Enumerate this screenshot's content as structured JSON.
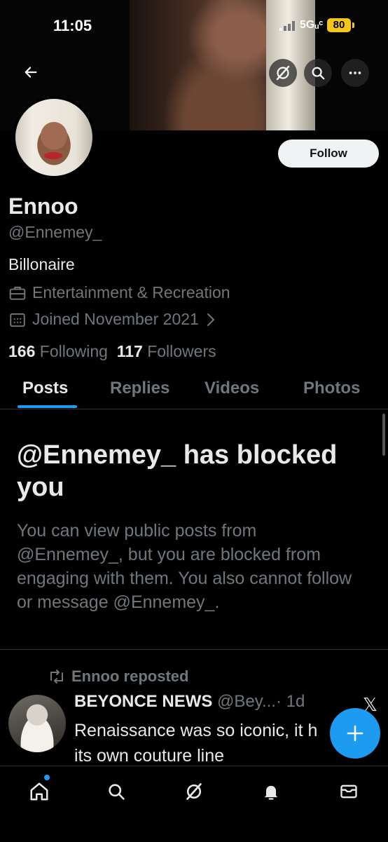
{
  "status_bar": {
    "time": "11:05",
    "network": "5Gᵤᶜ",
    "battery": "80"
  },
  "profile": {
    "name": "Ennoo",
    "handle": "@Ennemey_",
    "bio": "Billonaire",
    "category": "Entertainment & Recreation",
    "joined": "Joined November 2021",
    "following_count": "166",
    "following_label": "Following",
    "followers_count": "117",
    "followers_label": "Followers",
    "follow_button": "Follow"
  },
  "tabs": [
    "Posts",
    "Replies",
    "Videos",
    "Photos"
  ],
  "blocked": {
    "title": "@Ennemey_ has blocked you",
    "body": "You can view public posts from @Ennemey_, but you are blocked from engaging with them. You also cannot follow or message @Ennemey_."
  },
  "post": {
    "repost_label": "Ennoo reposted",
    "author_name": "BEYONCE NEWS",
    "author_handle": "@Bey...",
    "age": "· 1d",
    "text": "Renaissance was so iconic, it h its own couture line"
  },
  "colors": {
    "accent": "#1d9bf0",
    "muted": "#71767b",
    "text": "#e7e9ea",
    "battery": "#f5c518"
  },
  "icons": [
    "back-arrow-icon",
    "grok-icon",
    "search-icon",
    "more-icon",
    "briefcase-icon",
    "calendar-icon",
    "chevron-right-icon",
    "repost-icon",
    "x-logo-icon",
    "plus-icon",
    "home-icon",
    "notifications-icon",
    "messages-icon"
  ]
}
